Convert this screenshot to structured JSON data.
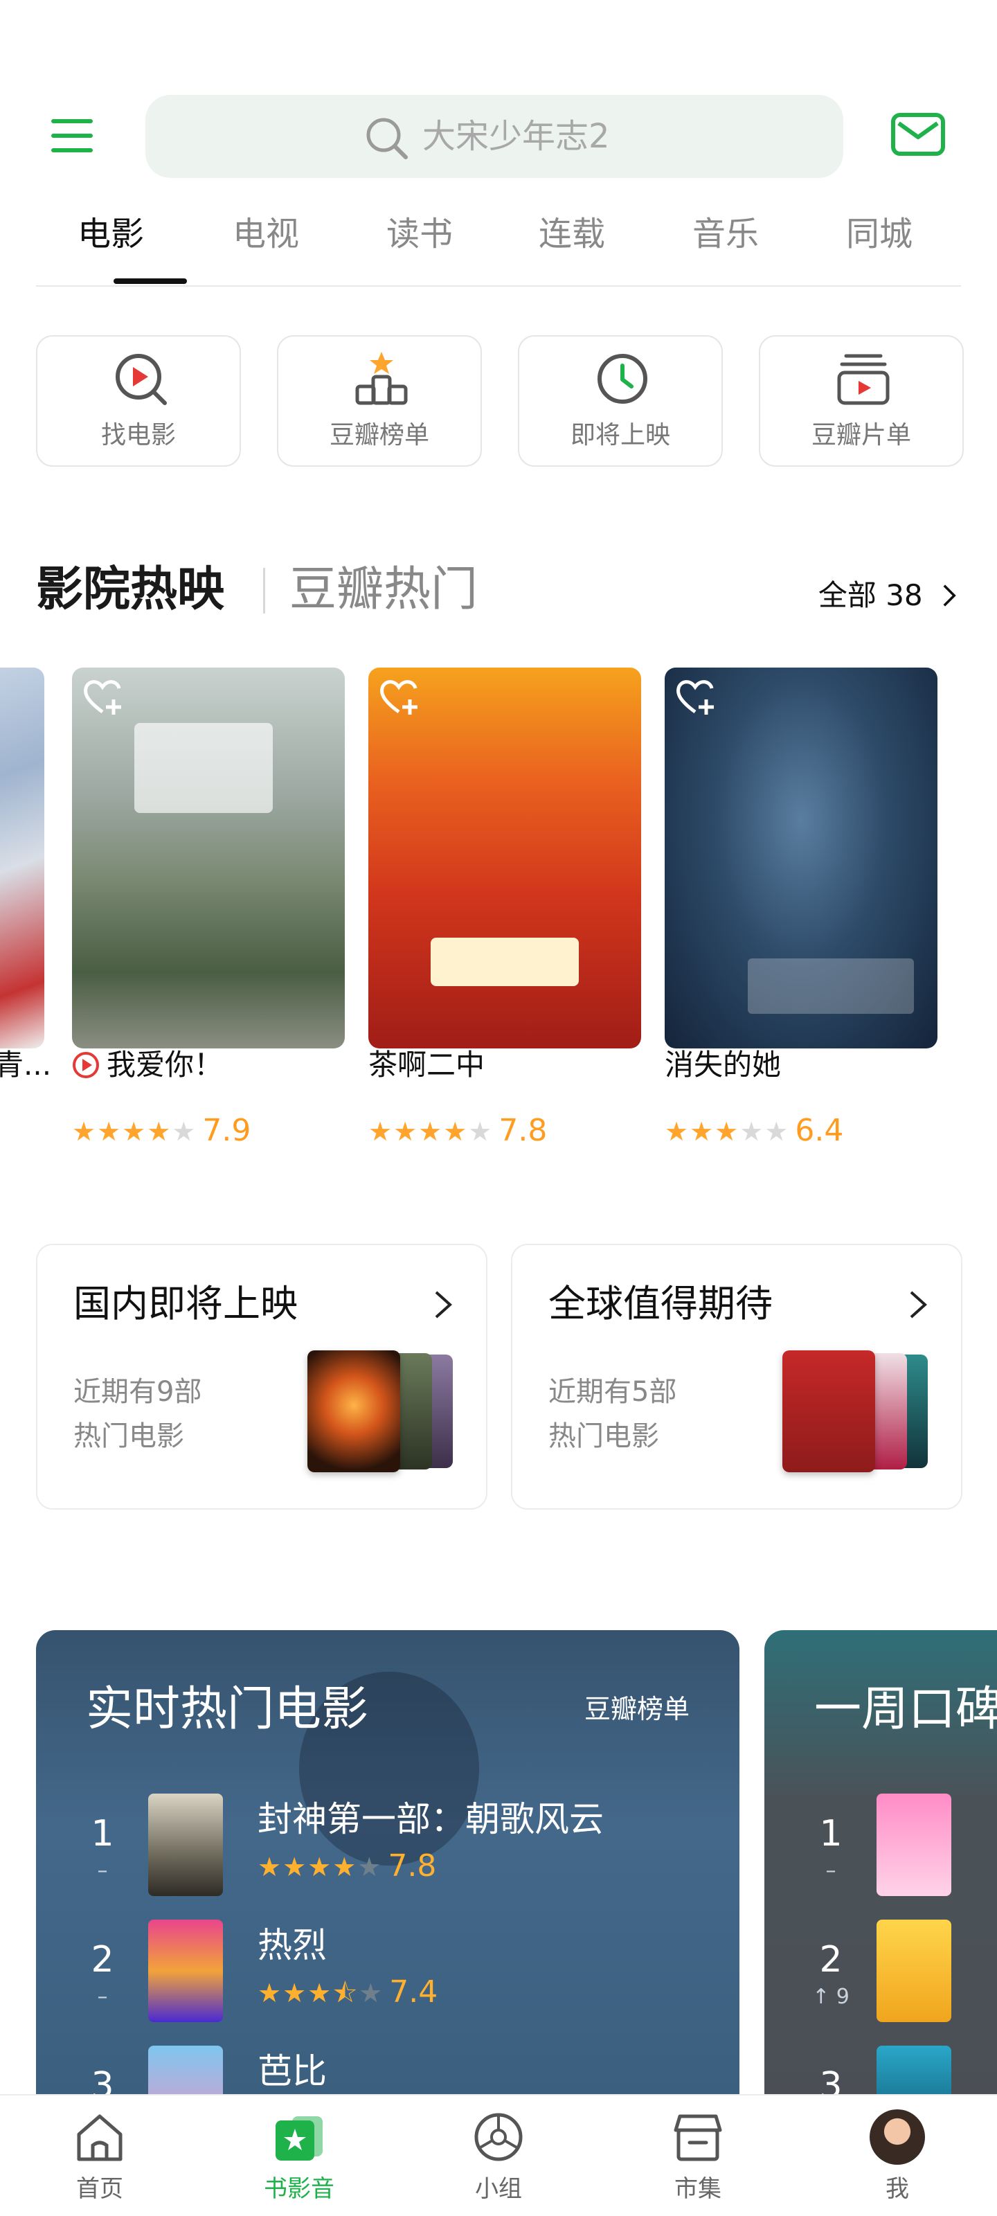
{
  "header": {
    "search_placeholder": "大宋少年志2",
    "icons": {
      "menu": "menu-icon",
      "search": "search-icon",
      "mail": "mail-icon"
    }
  },
  "tabs": [
    "电影",
    "电视",
    "读书",
    "连载",
    "音乐",
    "同城"
  ],
  "active_tab": 0,
  "quick_entries": [
    {
      "label": "找电影",
      "icon": "play-search-icon"
    },
    {
      "label": "豆瓣榜单",
      "icon": "podium-icon"
    },
    {
      "label": "即将上映",
      "icon": "clock-icon"
    },
    {
      "label": "豆瓣片单",
      "icon": "film-list-icon"
    }
  ],
  "now_showing": {
    "title": "影院热映",
    "alt_title": "豆瓣热门",
    "see_all_label": "全部",
    "see_all_count": "38",
    "partial_title": "青...",
    "movies": [
      {
        "title": "我爱你！",
        "rating": "7.9",
        "stars": 4,
        "playing": true
      },
      {
        "title": "茶啊二中",
        "rating": "7.8",
        "stars": 4,
        "playing": false
      },
      {
        "title": "消失的她",
        "rating": "6.4",
        "stars": 3,
        "playing": false
      }
    ]
  },
  "upcoming": [
    {
      "title": "国内即将上映",
      "desc1": "近期有9部",
      "desc2": "热门电影"
    },
    {
      "title": "全球值得期待",
      "desc1": "近期有5部",
      "desc2": "热门电影"
    }
  ],
  "rankings": {
    "realtime": {
      "title": "实时热门电影",
      "link": "豆瓣榜单",
      "items": [
        {
          "rank": "1",
          "change": "–",
          "name": "封神第一部：朝歌风云",
          "rating": "7.8",
          "stars": 4
        },
        {
          "rank": "2",
          "change": "–",
          "name": "热烈",
          "rating": "7.4",
          "stars": 3.5
        },
        {
          "rank": "3",
          "change": "",
          "name": "芭比",
          "rating": "",
          "stars": 0
        }
      ]
    },
    "weekly": {
      "title": "一周口碑",
      "items": [
        {
          "rank": "1",
          "change": "–"
        },
        {
          "rank": "2",
          "change": "↑ 9"
        },
        {
          "rank": "3",
          "change": ""
        }
      ]
    }
  },
  "bottom_nav": [
    {
      "label": "首页",
      "icon": "home-icon"
    },
    {
      "label": "书影音",
      "icon": "star-ticket-icon"
    },
    {
      "label": "小组",
      "icon": "group-ball-icon"
    },
    {
      "label": "市集",
      "icon": "market-icon"
    },
    {
      "label": "我",
      "icon": "avatar-icon"
    }
  ],
  "active_nav": 1,
  "colors": {
    "accent": "#1fb24b",
    "star": "#ffa42c",
    "rank_panel": "#3f617e",
    "rank_panel_2": "#4a4f55"
  }
}
